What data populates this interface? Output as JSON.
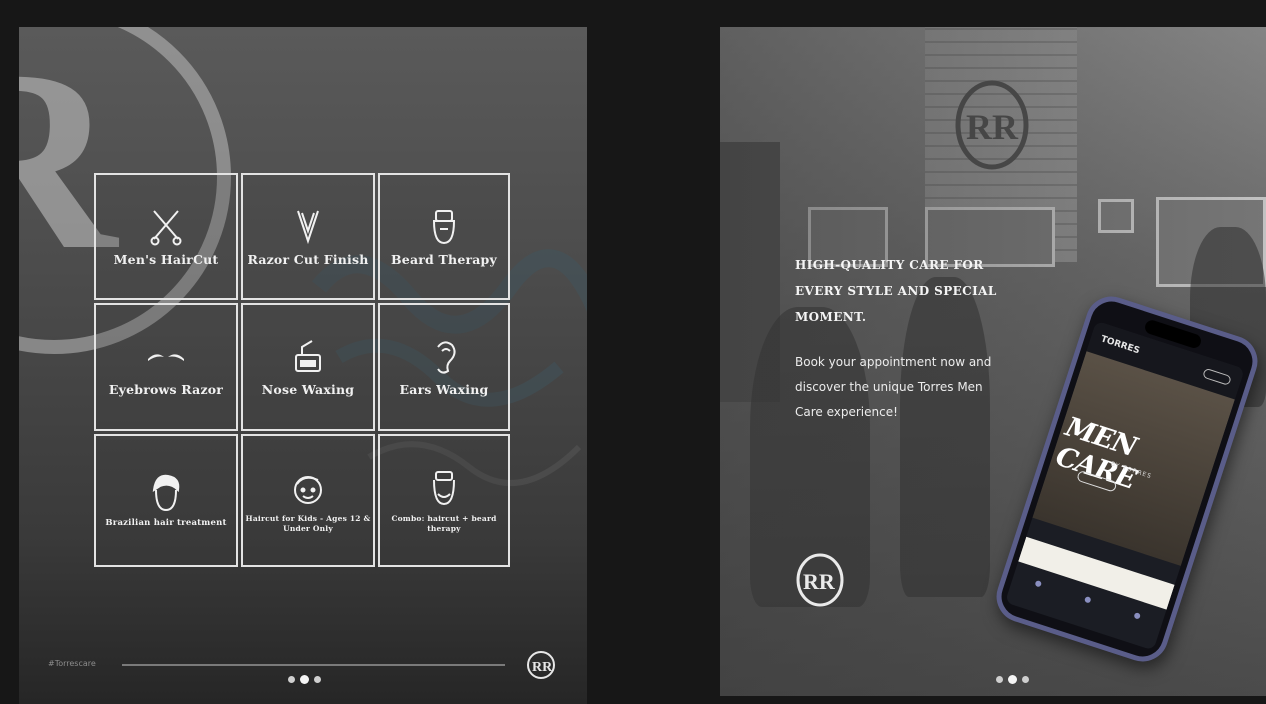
{
  "services_card": {
    "services": [
      {
        "label": "Men's HairCut",
        "icon": "scissors-comb-icon"
      },
      {
        "label": "Razor Cut Finish",
        "icon": "straight-razor-icon"
      },
      {
        "label": "Beard Therapy",
        "icon": "beard-icon"
      },
      {
        "label": "Eyebrows Razor",
        "icon": "eyebrows-icon"
      },
      {
        "label": "Nose Waxing",
        "icon": "wax-pot-icon"
      },
      {
        "label": "Ears Waxing",
        "icon": "ear-icon"
      },
      {
        "label": "Brazilian hair treatment",
        "icon": "hair-head-icon"
      },
      {
        "label": "Haircut for Kids - Ages 12 & Under Only",
        "icon": "kid-face-icon"
      },
      {
        "label": "Combo: haircut + beard therapy",
        "icon": "combo-face-icon"
      }
    ],
    "footer_tag": "#Torrescare",
    "carousel": {
      "count": 3,
      "active": 1
    }
  },
  "booking_card": {
    "headline": "HIGH-QUALITY CARE FOR EVERY STYLE AND SPECIAL MOMENT.",
    "body": "Book your appointment now and discover the unique Torres Men Care experience!",
    "phone": {
      "brand": "TORRES",
      "hero_title": "MEN CARE",
      "hero_subtitle": "BY TORRES"
    },
    "carousel": {
      "count": 3,
      "active": 1
    }
  },
  "colors": {
    "background": "#171717",
    "phone_frame": "#5a5d89",
    "text": "#f1f1f1"
  }
}
